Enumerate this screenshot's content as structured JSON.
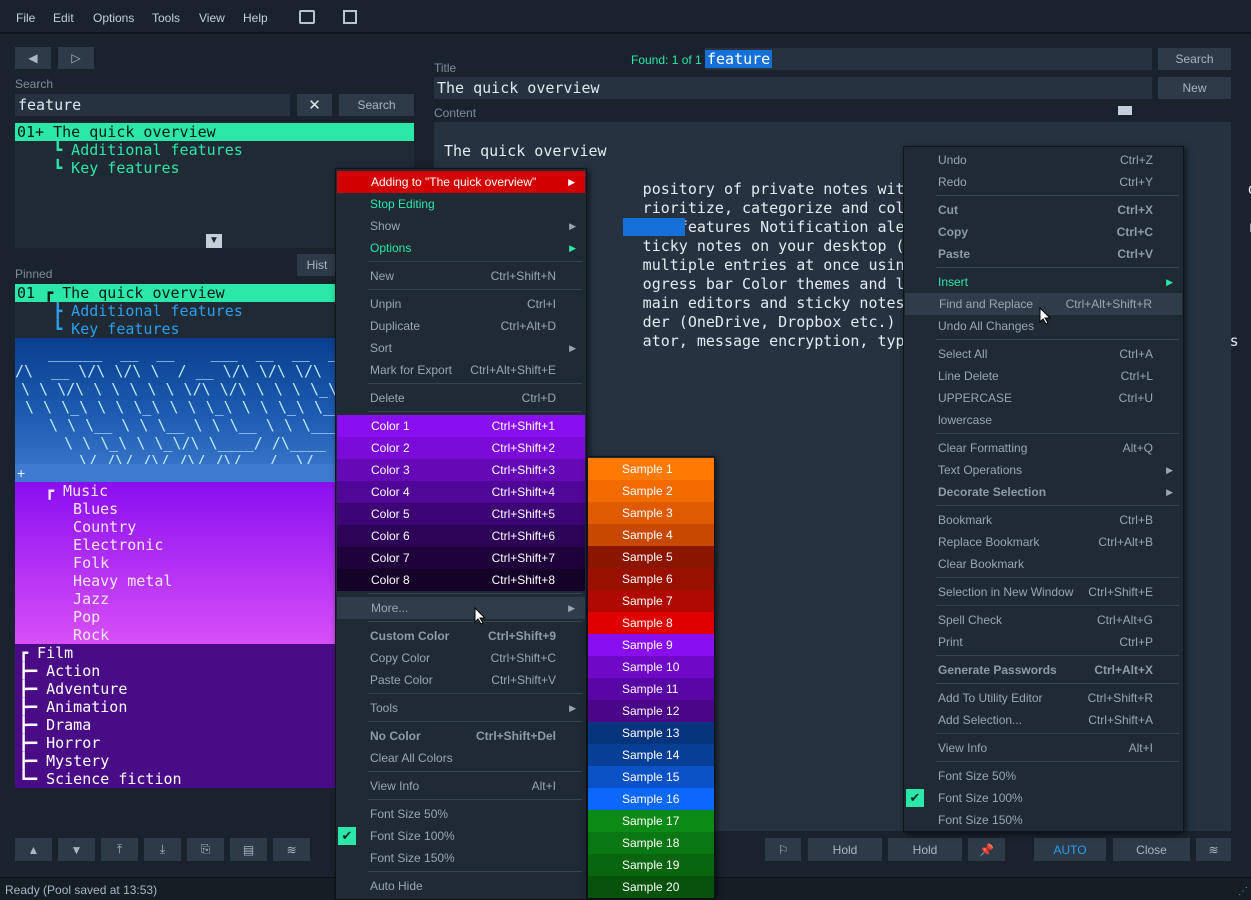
{
  "menu": [
    "File",
    "Edit",
    "Options",
    "Tools",
    "View",
    "Help"
  ],
  "left": {
    "search_label": "Search",
    "search_value": "feature",
    "clear_label": "✕",
    "search_button": "Search",
    "results": [
      "01+ The quick overview",
      "    ┗ Additional features",
      "    ┗ Key features"
    ],
    "pinned_label": "Pinned",
    "hist_label": "Hist",
    "pinned": [
      "01 ┏ The quick overview",
      "    ┣ Additional features",
      "    ┗ Key features"
    ],
    "banner": [
      "  ______  __  __    ___  __  __  ___",
      "/\\  __ \\/\\ \\/\\ \\  / __ \\/\\ \\/\\ \\/\\",
      "\\ \\ \\/\\ \\ \\ \\ \\ \\ \\/\\ \\/\\ \\ \\ \\ \\_\\",
      "\\ \\ \\_\\ \\ \\ \\_\\ \\ \\ \\_\\ \\ \\ \\_\\ \\___",
      "  \\ \\ \\__ \\ \\ \\__ \\ \\ \\__ \\ \\ \\____",
      "   \\ \\ \\_\\ \\ \\_\\/\\ \\____/ /\\____",
      "    \\/_/\\/_/\\/_/\\/_/\\/___/  \\/____"
    ],
    "plus": "+",
    "music": [
      "┏ Music",
      "  Blues",
      "  Country",
      "  Electronic",
      "  Folk",
      "  Heavy metal",
      "  Jazz",
      "  Pop",
      "  Rock"
    ],
    "film": [
      "┏ Film",
      "┣━ Action",
      "┣━ Adventure",
      "┣━ Animation",
      "┣━ Drama",
      "┣━ Horror",
      "┣━ Mystery",
      "┗━ Science fiction"
    ]
  },
  "editor": {
    "found": "Found: 1 of 1",
    "find_value": "feature",
    "search_button": "Search",
    "title_label": "Title",
    "title_value": "The quick overview",
    "new_button": "New",
    "content_label": "Content",
    "lines": [
      "The quick overview",
      "",
      "                      pository of private notes with fast                                on",
      "                      rioritize, categorize and colorize",
      "                      kup features Notification alerts wi                                rator",
      "                      ticky notes on your desktop (only v",
      "                      multiple entries at once using the",
      "                      ogress bar Color themes and lots o",
      "                      main editors and sticky notes Place",
      "                      der (OneDrive, Dropbox etc.) to acc",
      "                      ator, message encryption, typewrite                              s"
    ],
    "buttons": [
      "Hold",
      "Hold",
      "AUTO",
      "Close"
    ]
  },
  "status": "Ready (Pool saved at 13:53)",
  "menu1": [
    {
      "t": "Adding to \"The quick overview\"",
      "s": "",
      "ar": true,
      "bg": "#d20000",
      "c": "#ffffff"
    },
    {
      "t": "Stop Editing",
      "s": "",
      "c": "#2be8a9"
    },
    {
      "t": "Show",
      "s": "",
      "ar": true
    },
    {
      "t": "Options",
      "s": "",
      "ar": true,
      "c": "#2be8a9"
    },
    {
      "sep": true
    },
    {
      "t": "New",
      "s": "Ctrl+Shift+N"
    },
    {
      "sep": true
    },
    {
      "t": "Unpin",
      "s": "Ctrl+I"
    },
    {
      "t": "Duplicate",
      "s": "Ctrl+Alt+D"
    },
    {
      "t": "Sort",
      "s": "",
      "ar": true
    },
    {
      "t": "Mark for Export",
      "s": "Ctrl+Alt+Shift+E"
    },
    {
      "sep": true
    },
    {
      "t": "Delete",
      "s": "Ctrl+D"
    },
    {
      "sep": true
    },
    {
      "t": "Color 1",
      "s": "Ctrl+Shift+1",
      "bg": "#8a0ff0",
      "c": "#ffffff"
    },
    {
      "t": "Color 2",
      "s": "Ctrl+Shift+2",
      "bg": "#7a0bd8",
      "c": "#ffffff"
    },
    {
      "t": "Color 3",
      "s": "Ctrl+Shift+3",
      "bg": "#6508b6",
      "c": "#ffffff"
    },
    {
      "t": "Color 4",
      "s": "Ctrl+Shift+4",
      "bg": "#500696",
      "c": "#ffffff"
    },
    {
      "t": "Color 5",
      "s": "Ctrl+Shift+5",
      "bg": "#3c0475",
      "c": "#ffffff"
    },
    {
      "t": "Color 6",
      "s": "Ctrl+Shift+6",
      "bg": "#2c0356",
      "c": "#ffffff"
    },
    {
      "t": "Color 7",
      "s": "Ctrl+Shift+7",
      "bg": "#1f023c",
      "c": "#ffffff"
    },
    {
      "t": "Color 8",
      "s": "Ctrl+Shift+8",
      "bg": "#150228",
      "c": "#ffffff"
    },
    {
      "sep": true
    },
    {
      "t": "More...",
      "s": "",
      "ar": true,
      "bg": "#2f3d4b"
    },
    {
      "sep": true
    },
    {
      "t": "Custom Color",
      "s": "Ctrl+Shift+9",
      "b": true
    },
    {
      "t": "Copy Color",
      "s": "Ctrl+Shift+C"
    },
    {
      "t": "Paste Color",
      "s": "Ctrl+Shift+V"
    },
    {
      "sep": true
    },
    {
      "t": "Tools",
      "s": "",
      "ar": true
    },
    {
      "sep": true
    },
    {
      "t": "No Color",
      "s": "Ctrl+Shift+Del",
      "b": true
    },
    {
      "t": "Clear All Colors",
      "s": ""
    },
    {
      "sep": true
    },
    {
      "t": "View Info",
      "s": "Alt+I"
    },
    {
      "sep": true
    },
    {
      "t": "Font Size 50%",
      "s": ""
    },
    {
      "t": "Font Size 100%",
      "s": "",
      "chk": true
    },
    {
      "t": "Font Size 150%",
      "s": ""
    },
    {
      "sep": true
    },
    {
      "t": "Auto Hide",
      "s": ""
    }
  ],
  "samples": [
    {
      "t": "Sample 1",
      "bg": "#ff7a00"
    },
    {
      "t": "Sample 2",
      "bg": "#f26b00"
    },
    {
      "t": "Sample 3",
      "bg": "#e05a00"
    },
    {
      "t": "Sample 4",
      "bg": "#c84800"
    },
    {
      "t": "Sample 5",
      "bg": "#8a1600"
    },
    {
      "t": "Sample 6",
      "bg": "#9a1000"
    },
    {
      "t": "Sample 7",
      "bg": "#b00a00"
    },
    {
      "t": "Sample 8",
      "bg": "#e00000"
    },
    {
      "t": "Sample 9",
      "bg": "#8a0ff0"
    },
    {
      "t": "Sample 10",
      "bg": "#7008c8"
    },
    {
      "t": "Sample 11",
      "bg": "#5a06a6"
    },
    {
      "t": "Sample 12",
      "bg": "#4a0588"
    },
    {
      "t": "Sample 13",
      "bg": "#06357e"
    },
    {
      "t": "Sample 14",
      "bg": "#083f96"
    },
    {
      "t": "Sample 15",
      "bg": "#0a52c6"
    },
    {
      "t": "Sample 16",
      "bg": "#0a68ff"
    },
    {
      "t": "Sample 17",
      "bg": "#0c8a16"
    },
    {
      "t": "Sample 18",
      "bg": "#0a7812"
    },
    {
      "t": "Sample 19",
      "bg": "#08660f"
    },
    {
      "t": "Sample 20",
      "bg": "#05520a"
    }
  ],
  "menu2": [
    {
      "t": "Undo",
      "s": "Ctrl+Z"
    },
    {
      "t": "Redo",
      "s": "Ctrl+Y"
    },
    {
      "sep": true
    },
    {
      "t": "Cut",
      "s": "Ctrl+X",
      "b": true
    },
    {
      "t": "Copy",
      "s": "Ctrl+C",
      "b": true
    },
    {
      "t": "Paste",
      "s": "Ctrl+V",
      "b": true
    },
    {
      "sep": true
    },
    {
      "t": "Insert",
      "s": "",
      "ar": true,
      "c": "#2be8a9"
    },
    {
      "t": "Find and Replace",
      "s": "Ctrl+Alt+Shift+R",
      "bg": "#2f3d4b"
    },
    {
      "t": "Undo All Changes",
      "s": ""
    },
    {
      "sep": true
    },
    {
      "t": "Select All",
      "s": "Ctrl+A"
    },
    {
      "t": "Line Delete",
      "s": "Ctrl+L"
    },
    {
      "t": "UPPERCASE",
      "s": "Ctrl+U"
    },
    {
      "t": "lowercase",
      "s": ""
    },
    {
      "sep": true
    },
    {
      "t": "Clear Formatting",
      "s": "Alt+Q"
    },
    {
      "t": "Text Operations",
      "s": "",
      "ar": true
    },
    {
      "t": "Decorate Selection",
      "s": "",
      "ar": true,
      "b": true
    },
    {
      "sep": true
    },
    {
      "t": "Bookmark",
      "s": "Ctrl+B"
    },
    {
      "t": "Replace Bookmark",
      "s": "Ctrl+Alt+B"
    },
    {
      "t": "Clear Bookmark",
      "s": ""
    },
    {
      "sep": true
    },
    {
      "t": "Selection in New Window",
      "s": "Ctrl+Shift+E"
    },
    {
      "sep": true
    },
    {
      "t": "Spell Check",
      "s": "Ctrl+Alt+G"
    },
    {
      "t": "Print",
      "s": "Ctrl+P"
    },
    {
      "sep": true
    },
    {
      "t": "Generate Passwords",
      "s": "Ctrl+Alt+X",
      "b": true
    },
    {
      "sep": true
    },
    {
      "t": "Add To Utility Editor",
      "s": "Ctrl+Shift+R"
    },
    {
      "t": "Add Selection...",
      "s": "Ctrl+Shift+A"
    },
    {
      "sep": true
    },
    {
      "t": "View Info",
      "s": "Alt+I"
    },
    {
      "sep": true
    },
    {
      "t": "Font Size 50%",
      "s": ""
    },
    {
      "t": "Font Size 100%",
      "s": "",
      "chk": true
    },
    {
      "t": "Font Size 150%",
      "s": ""
    }
  ]
}
